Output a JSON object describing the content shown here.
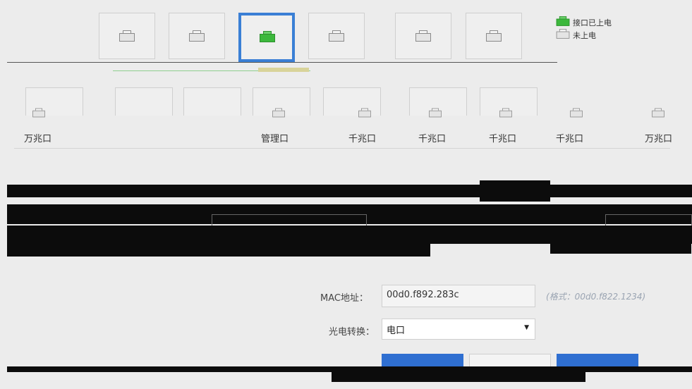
{
  "legend": {
    "powered": "接口已上电",
    "unpowered": "未上电"
  },
  "row2_labels": [
    "万兆口",
    "管理口",
    "千兆口",
    "千兆口",
    "千兆口",
    "千兆口",
    "万兆口"
  ],
  "form": {
    "mac_label": "MAC地址：",
    "mac_value": "00d0.f892.283c",
    "mac_hint": "(格式：00d0.f822.1234)",
    "optic_label": "光电转换：",
    "optic_value": "电口"
  },
  "colors": {
    "selected_border": "#3a7fd5",
    "powered_icon": "#3cb83c",
    "primary_button": "#2f6fd1"
  }
}
